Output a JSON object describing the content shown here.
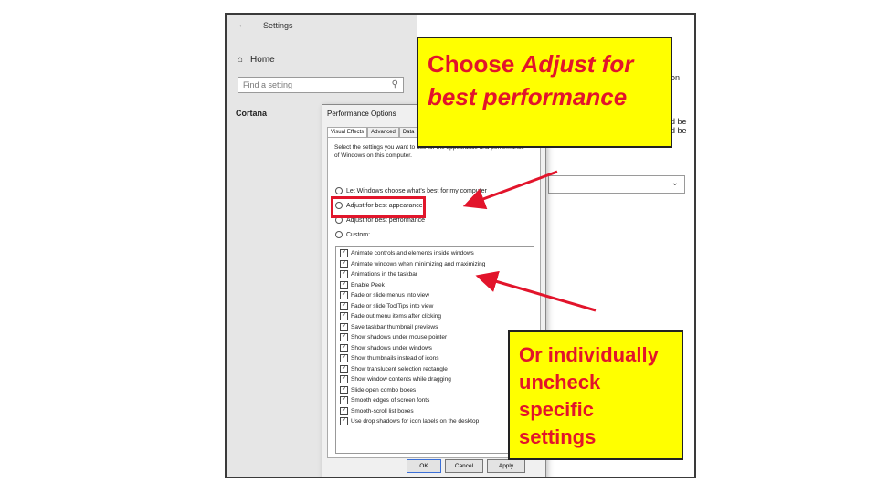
{
  "settings": {
    "title": "Settings",
    "home_label": "Home",
    "search_placeholder": "Find a setting",
    "section": "Cortana",
    "right_fragments": [
      "on",
      "d be",
      "d be"
    ]
  },
  "dialog": {
    "title": "Performance Options",
    "tabs": [
      "Visual Effects",
      "Advanced",
      "Data"
    ],
    "description": "Select the settings you want to use for the appearance and performance of Windows on this computer.",
    "radios": [
      "Let Windows choose what's best for my computer",
      "Adjust for best appearance",
      "Adjust for best performance",
      "Custom:"
    ],
    "checkboxes": [
      "Animate controls and elements inside windows",
      "Animate windows when minimizing and maximizing",
      "Animations in the taskbar",
      "Enable Peek",
      "Fade or slide menus into view",
      "Fade or slide ToolTips into view",
      "Fade out menu items after clicking",
      "Save taskbar thumbnail previews",
      "Show shadows under mouse pointer",
      "Show shadows under windows",
      "Show thumbnails instead of icons",
      "Show translucent selection rectangle",
      "Show window contents while dragging",
      "Slide open combo boxes",
      "Smooth edges of screen fonts",
      "Smooth-scroll list boxes",
      "Use drop shadows for icon labels on the desktop"
    ],
    "buttons": {
      "ok": "OK",
      "cancel": "Cancel",
      "apply": "Apply"
    }
  },
  "annotations": {
    "note1_line1_prefix": "Choose ",
    "note1_line1_em": "Adjust for",
    "note1_line2_em": "best performance",
    "note2_lines": [
      "Or individually",
      "uncheck",
      "specific",
      "settings"
    ],
    "accent_color": "#e2142b",
    "note_bg": "#ffff00"
  }
}
